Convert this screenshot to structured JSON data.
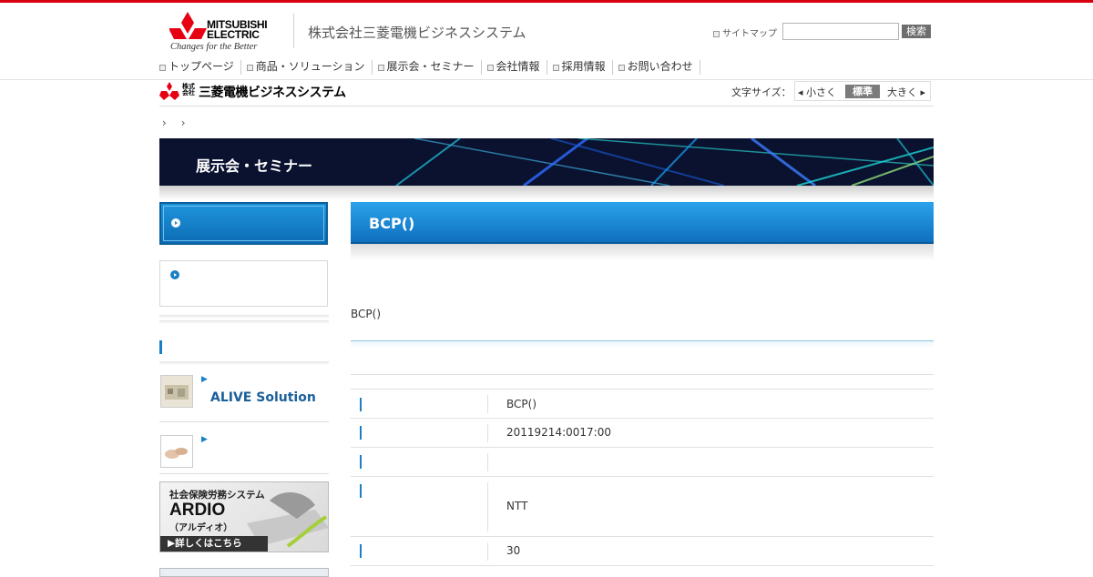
{
  "header": {
    "logo_line1": "MITSUBISHI",
    "logo_line2": "ELECTRIC",
    "logo_tagline": "Changes for the Better",
    "company_name": "株式会社三菱電機ビジネスシステム",
    "sitemap_label": "サイトマップ",
    "search_placeholder": "",
    "search_button": "検索"
  },
  "global_nav": [
    {
      "label": "トップページ"
    },
    {
      "label": "商品・ソリューション"
    },
    {
      "label": "展示会・セミナー"
    },
    {
      "label": "会社情報"
    },
    {
      "label": "採用情報"
    },
    {
      "label": "お問い合わせ"
    }
  ],
  "brand_row": {
    "kabu_top": "株式",
    "kabu_bottom": "会社",
    "name": "三菱電機ビジネスシステム",
    "font_size_label": "文字サイズ：",
    "small": "◂ 小さく",
    "normal": "標準",
    "large": "大きく ▸"
  },
  "breadcrumb": "››",
  "banner": {
    "title": "展示会・セミナー"
  },
  "sidebar": {
    "alive_label": "ALIVE Solution",
    "ardio": {
      "line1": "社会保険労務システム",
      "line2": "ARDIO",
      "line3": "（アルディオ）",
      "link": "▶詳しくはこちら"
    }
  },
  "main": {
    "title": "BCP()",
    "intro": "BCP()",
    "rows": [
      {
        "value": "BCP()"
      },
      {
        "value": "20119214:0017:00"
      },
      {
        "value": ""
      },
      {
        "value": "NTT"
      },
      {
        "value": "30"
      }
    ]
  },
  "colors": {
    "accent_red": "#d7000f",
    "accent_blue": "#1a7fc4",
    "banner_bg": "#0a1230"
  }
}
